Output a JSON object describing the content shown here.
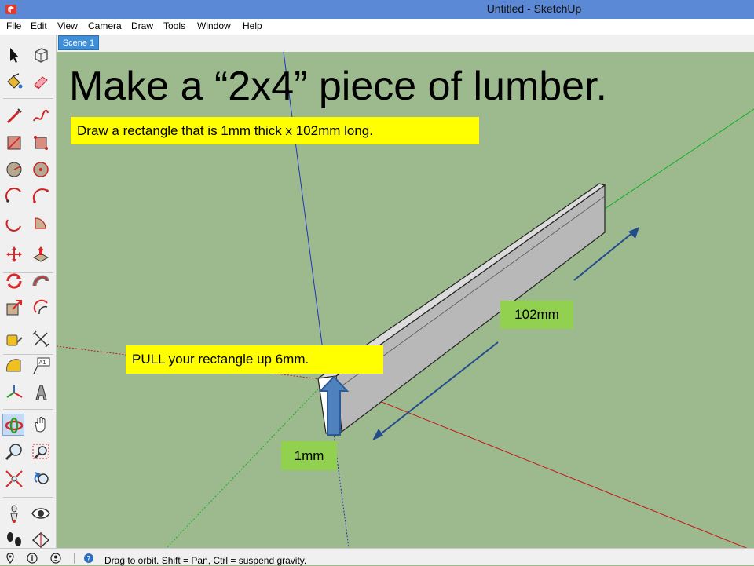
{
  "window": {
    "title": "Untitled - SketchUp",
    "icon": "sketchup-logo-icon"
  },
  "menu": [
    "File",
    "Edit",
    "View",
    "Camera",
    "Draw",
    "Tools",
    "Window",
    "Help"
  ],
  "scenes": [
    {
      "label": "Scene 1"
    }
  ],
  "slide": {
    "headline": "Make a “2x4” piece of lumber.",
    "instruction_draw": "Draw a rectangle that is 1mm thick x 102mm long.",
    "instruction_pull": "PULL your rectangle up 6mm.",
    "dim_length": "102mm",
    "dim_thickness": "1mm"
  },
  "tools": [
    "select-arrow-icon",
    "make-component-icon",
    "paint-bucket-icon",
    "eraser-icon",
    "pencil-line-icon",
    "freehand-icon",
    "rectangle-icon",
    "rotated-rectangle-icon",
    "circle-icon",
    "polygon-icon",
    "arc-icon",
    "two-point-arc-icon",
    "three-point-arc-icon",
    "pie-icon",
    "move-icon",
    "push-pull-icon",
    "rotate-icon",
    "follow-me-icon",
    "scale-icon",
    "offset-icon",
    "tape-measure-icon",
    "dimension-icon",
    "protractor-icon",
    "text-tool-icon",
    "axes-icon",
    "3d-text-icon",
    "orbit-icon",
    "pan-icon",
    "zoom-icon",
    "zoom-window-icon",
    "zoom-extents-icon",
    "previous-view-icon",
    "position-camera-icon",
    "look-around-icon",
    "walk-icon",
    "section-plane-icon"
  ],
  "status": {
    "text": "Drag to orbit. Shift = Pan, Ctrl = suspend gravity.",
    "icons": [
      "geo-location-icon",
      "credits-icon",
      "user-icon"
    ],
    "help_icon": "help-icon"
  },
  "colors": {
    "titlebar": "#5b89d6",
    "viewport_bg": "#9dba8e",
    "callout_yellow": "#ffff00",
    "callout_green": "#92d050",
    "arrow_blue": "#4f81bd",
    "scene_tab": "#3f8ed8"
  }
}
